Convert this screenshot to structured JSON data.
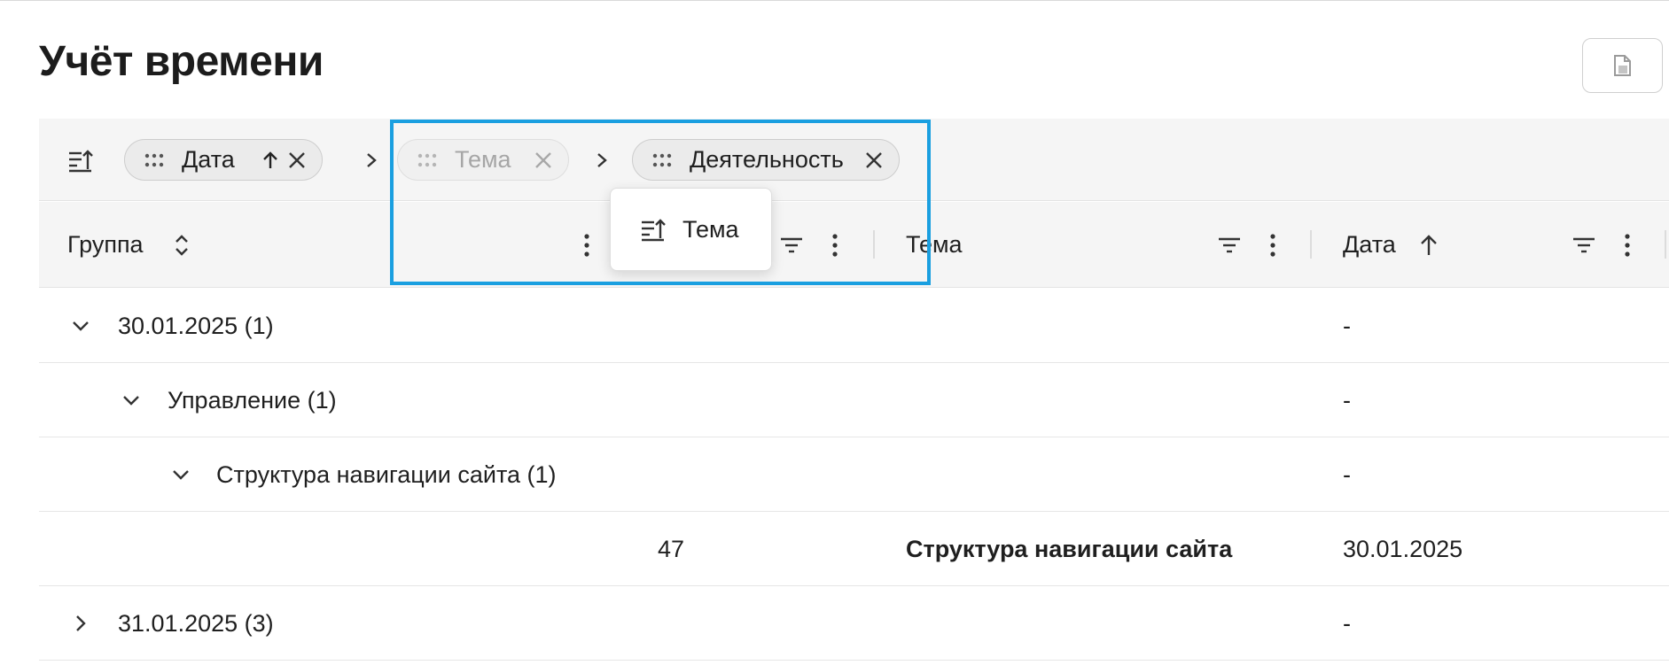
{
  "page": {
    "title": "Учёт времени"
  },
  "toolbar": {
    "copy_icon": "copy-icon"
  },
  "grouping": {
    "icon": "group-by-icon",
    "chips": [
      {
        "label": "Дата",
        "sort": "asc",
        "dimmed": false
      },
      {
        "label": "Тема",
        "dimmed": true
      },
      {
        "label": "Деятельность",
        "dimmed": false
      }
    ],
    "drag_preview": {
      "label": "Тема"
    }
  },
  "table": {
    "columns": [
      {
        "label": "Группа",
        "sort": "none"
      },
      {
        "label": "Тема"
      },
      {
        "label": "Дата",
        "sort": "asc"
      }
    ],
    "rows": [
      {
        "level": 0,
        "expanded": true,
        "group": "30.01.2025 (1)",
        "number": "",
        "topic": "",
        "date": "-"
      },
      {
        "level": 1,
        "expanded": true,
        "group": "Управление (1)",
        "number": "",
        "topic": "",
        "date": "-"
      },
      {
        "level": 2,
        "expanded": true,
        "group": "Структура навигации сайта (1)",
        "number": "",
        "topic": "",
        "date": "-"
      },
      {
        "level": 3,
        "group": "",
        "number": "47",
        "topic": "Структура навигации сайта",
        "date": "30.01.2025"
      },
      {
        "level": 0,
        "expanded": false,
        "group": "31.01.2025 (3)",
        "number": "",
        "topic": "",
        "date": "-"
      }
    ]
  },
  "colors": {
    "accent_highlight": "#1a9fe0",
    "link": "#5b82d6"
  }
}
